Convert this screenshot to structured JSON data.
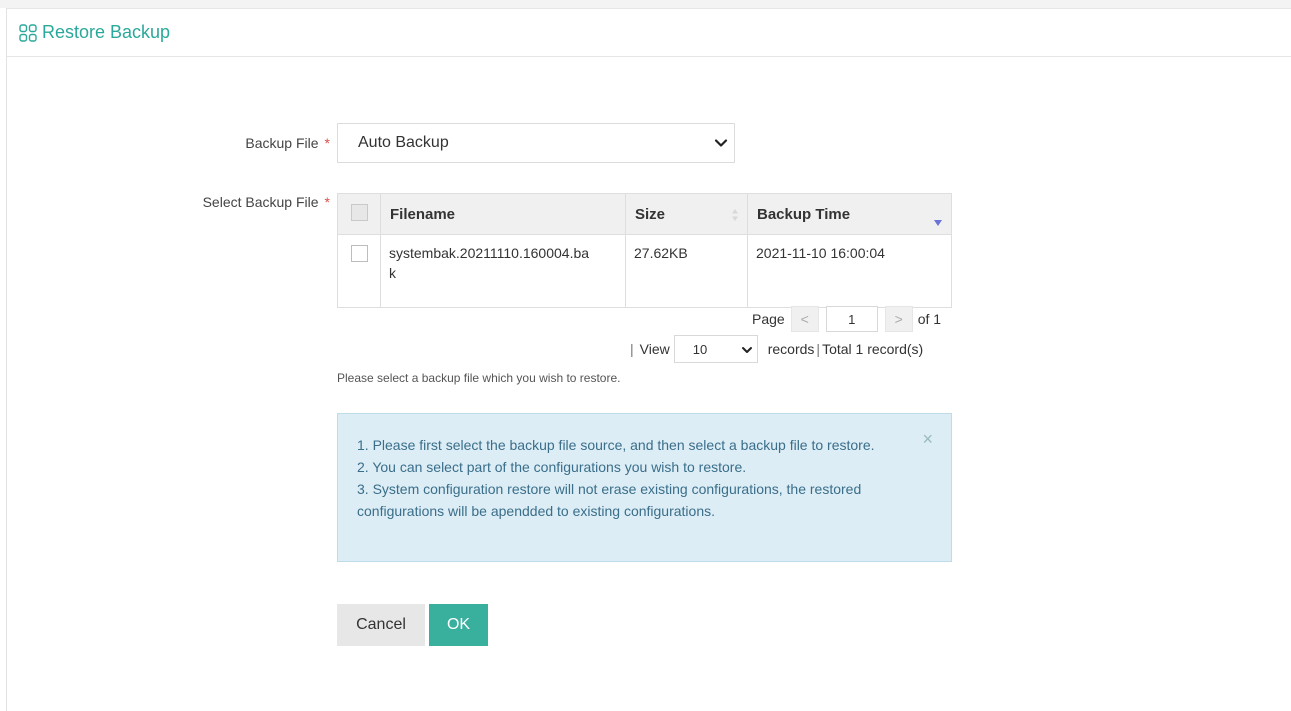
{
  "header": {
    "title": "Restore Backup",
    "icon": "grid-icon"
  },
  "form": {
    "backup_file_label": "Backup File",
    "select_backup_file_label": "Select Backup File",
    "required_mark": "*",
    "backup_file_value": "Auto Backup"
  },
  "table": {
    "columns": [
      "Filename",
      "Size",
      "Backup Time"
    ],
    "rows": [
      {
        "filename": "systembak.20211110.160004.ba",
        "filename_wrap": "k",
        "size": "27.62KB",
        "backup_time": "2021-11-10 16:00:04"
      }
    ]
  },
  "pager": {
    "page_label": "Page",
    "prev": "<",
    "next": ">",
    "current_page": "1",
    "of_label": "of 1",
    "separator": "|",
    "view_label": "View",
    "per_page": "10",
    "records_label": "records",
    "total_label": "Total 1 record(s)"
  },
  "hint": "Please select a backup file which you wish to restore.",
  "info": {
    "line1": "1. Please first select the backup file source, and then select a backup file to restore.",
    "line2": "2. You can select part of the configurations you wish to restore.",
    "line3": "3. System configuration restore will not erase existing configurations, the restored configurations will be apendded to existing configurations.",
    "close": "×"
  },
  "buttons": {
    "cancel": "Cancel",
    "ok": "OK"
  },
  "colors": {
    "accent": "#39b09e",
    "title": "#2aa89a",
    "info_bg": "#dcedf5",
    "info_text": "#3a6e8a",
    "required": "#e04b4b"
  }
}
